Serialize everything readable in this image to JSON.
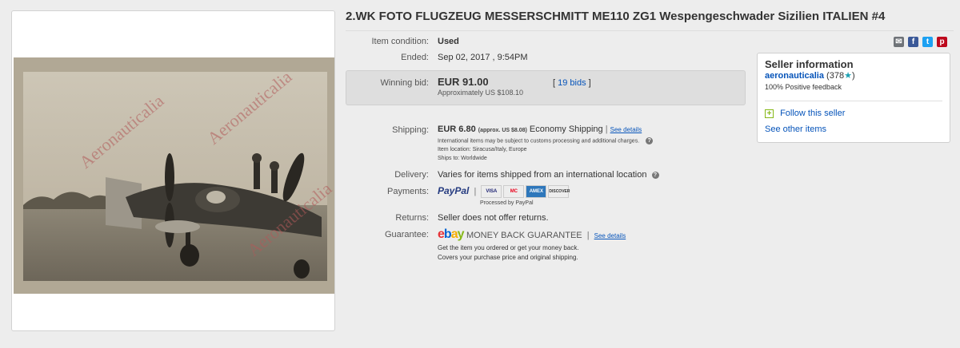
{
  "title": "2.WK FOTO FLUGZEUG MESSERSCHMITT ME110 ZG1 Wespengeschwader Sizilien ITALIEN #4",
  "photo": {
    "watermark": "Aeronauticalia"
  },
  "condition": {
    "label": "Item condition:",
    "value": "Used"
  },
  "ended": {
    "label": "Ended:",
    "value": "Sep 02, 2017 , 9:54PM"
  },
  "bid": {
    "label": "Winning bid:",
    "value": "EUR 91.00",
    "approx": "Approximately US $108.10",
    "bids_open": "[",
    "bids_link": "19 bids",
    "bids_close": "]"
  },
  "share": {
    "email_icon": "email-icon",
    "facebook_icon": "facebook-icon",
    "twitter_icon": "twitter-icon",
    "pinterest_icon": "pinterest-icon"
  },
  "shipping": {
    "label": "Shipping:",
    "amount": "EUR 6.80",
    "approx": "(approx. US $8.08)",
    "method": "Economy Shipping",
    "sep": "|",
    "details_link": "See details",
    "customs_note": "International items may be subject to customs processing and additional charges.",
    "location": "Item location:  Siracusa/Italy, Europe",
    "ships_to": "Ships to:  Worldwide"
  },
  "delivery": {
    "label": "Delivery:",
    "value": "Varies for items shipped from an international location"
  },
  "payments": {
    "label": "Payments:",
    "paypal": "PayPal",
    "processed": "Processed by PayPal",
    "cards": [
      "VISA",
      "MC",
      "AMEX",
      "DISCOVER"
    ]
  },
  "returns": {
    "label": "Returns:",
    "value": "Seller does not offer returns."
  },
  "guarantee": {
    "label": "Guarantee:",
    "ebay_e": "e",
    "ebay_b": "b",
    "ebay_a": "a",
    "ebay_y": "y",
    "title": "MONEY BACK GUARANTEE",
    "sep": "|",
    "details_link": "See details",
    "line1": "Get the item you ordered or get your money back.",
    "line2": "Covers your purchase price and original shipping."
  },
  "seller": {
    "heading": "Seller information",
    "name": "aeronauticalia",
    "score_open": "(378",
    "score_close": ")",
    "feedback": "100% Positive feedback",
    "follow": "Follow this seller",
    "see_other": "See other items"
  },
  "colors": {
    "link": "#0654ba",
    "paypal_dark": "#253b80",
    "paypal_light": "#179bd7",
    "ebay_red": "#e53238",
    "ebay_blue": "#0064d2",
    "ebay_yellow": "#f5af02",
    "ebay_green": "#86b817"
  }
}
